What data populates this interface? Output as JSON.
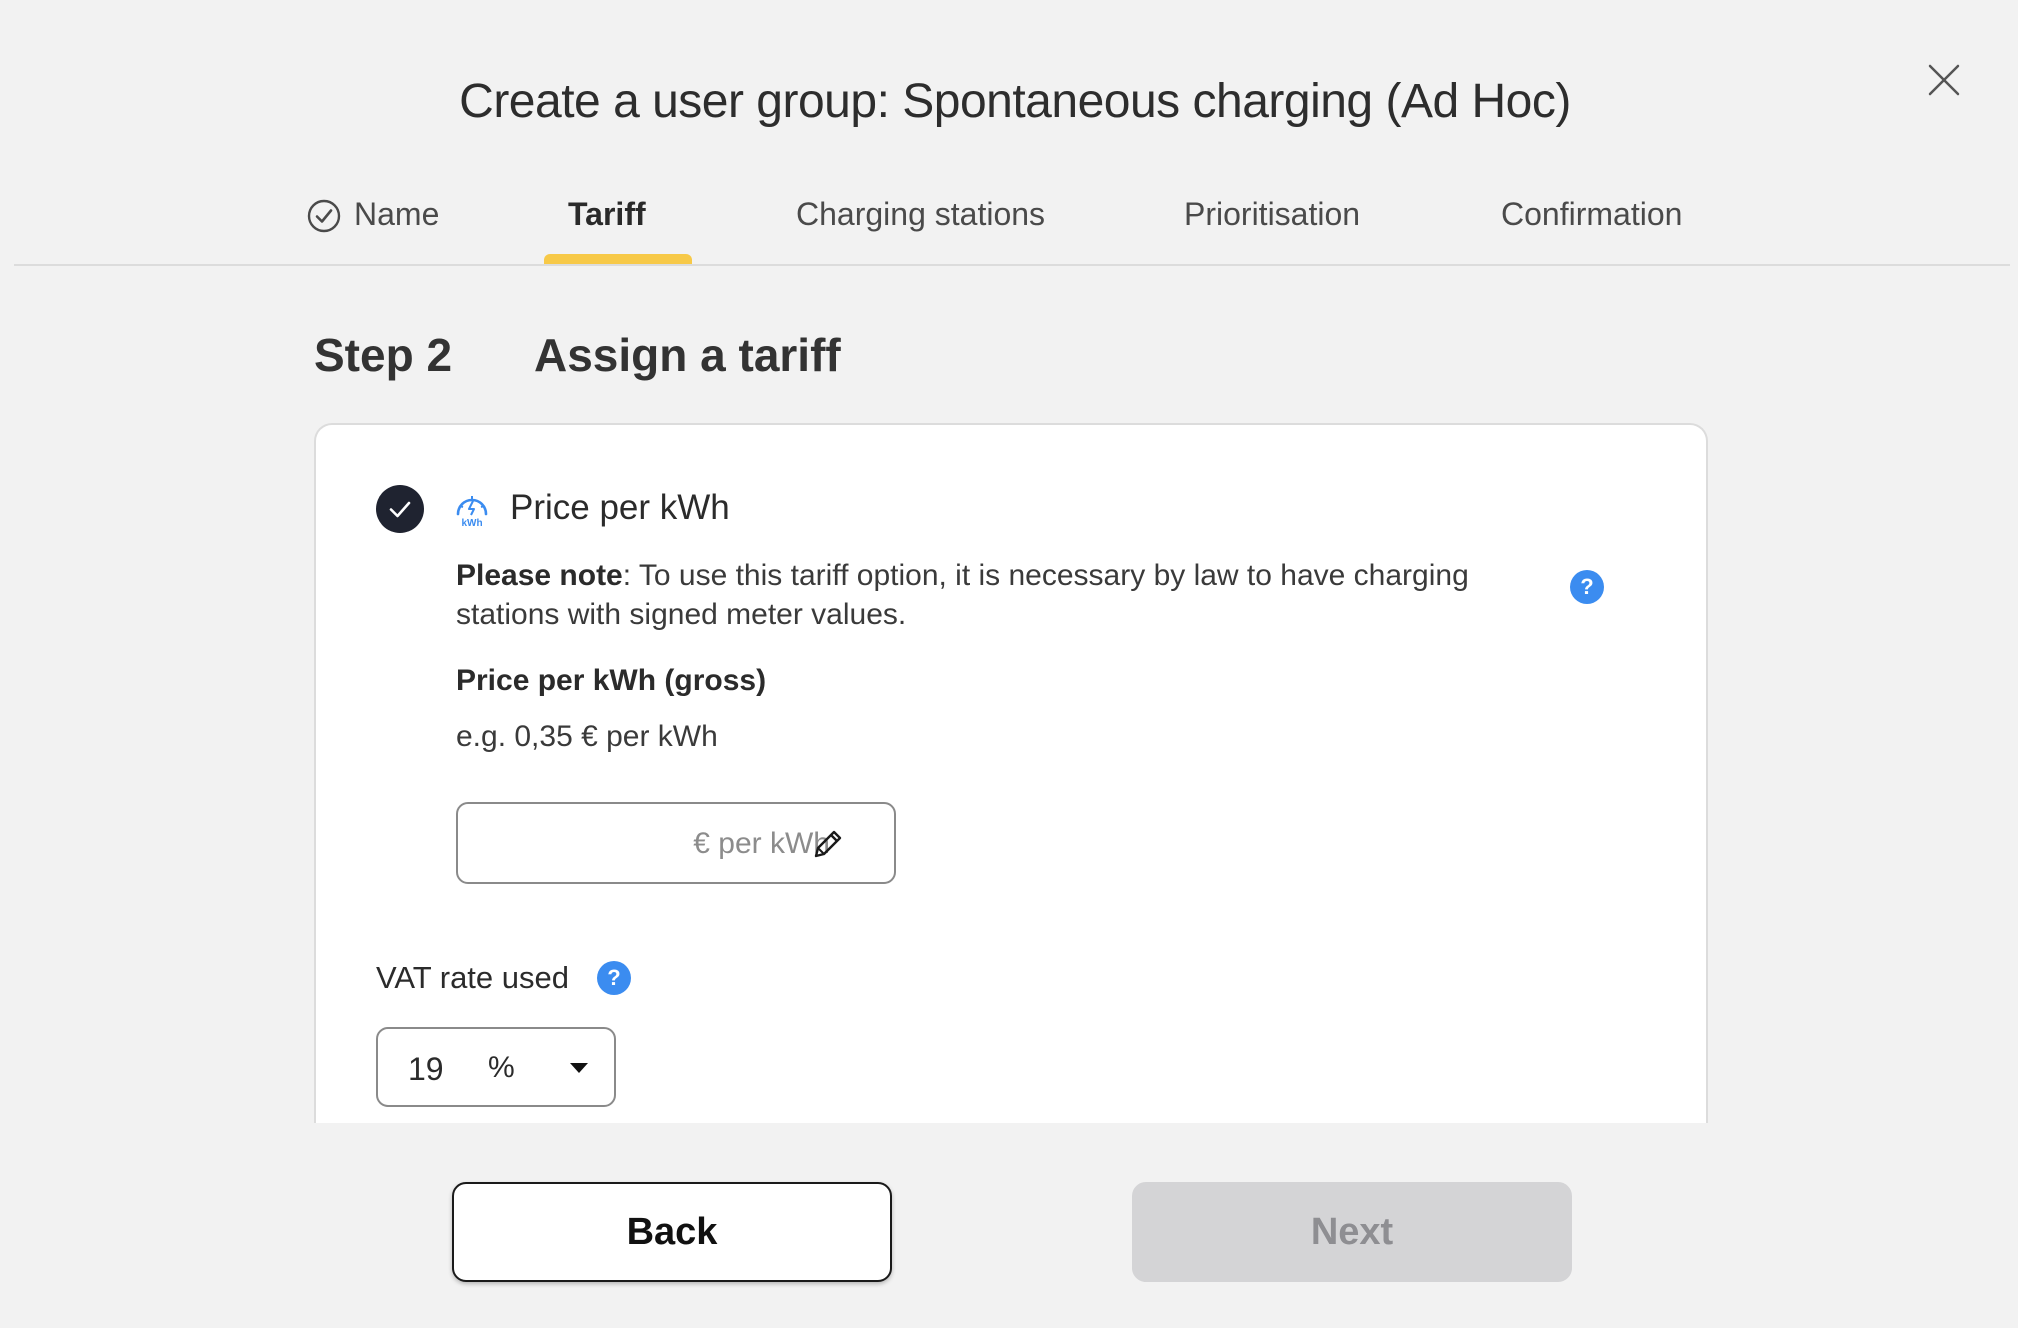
{
  "dialog": {
    "title": "Create a user group: Spontaneous charging (Ad Hoc)",
    "close_icon": "close-icon"
  },
  "tabs": [
    {
      "label": "Name",
      "completed": true,
      "icon": "check-circle-outline-icon"
    },
    {
      "label": "Tariff",
      "active": true
    },
    {
      "label": "Charging stations"
    },
    {
      "label": "Prioritisation"
    },
    {
      "label": "Confirmation"
    }
  ],
  "step": {
    "label": "Step 2",
    "title": "Assign a tariff"
  },
  "option": {
    "label": "Price per kWh",
    "selected": true,
    "icon": "kwh-meter-icon",
    "note_bold": "Please note",
    "note_text": ": To use this tariff option, it is necessary by law to have charging stations with signed meter values.",
    "field_label": "Price per kWh (gross)",
    "field_example": "e.g. 0,35 € per kWh",
    "input_value": "",
    "input_placeholder": "€ per kWh"
  },
  "vat": {
    "label": "VAT rate used",
    "value": "19",
    "unit": "%"
  },
  "footer": {
    "back_label": "Back",
    "next_label": "Next",
    "next_enabled": false
  },
  "colors": {
    "accent_yellow": "#f7c948",
    "help_blue": "#3b8cf0",
    "dark": "#1f2330",
    "disabled_bg": "#d4d4d6"
  }
}
